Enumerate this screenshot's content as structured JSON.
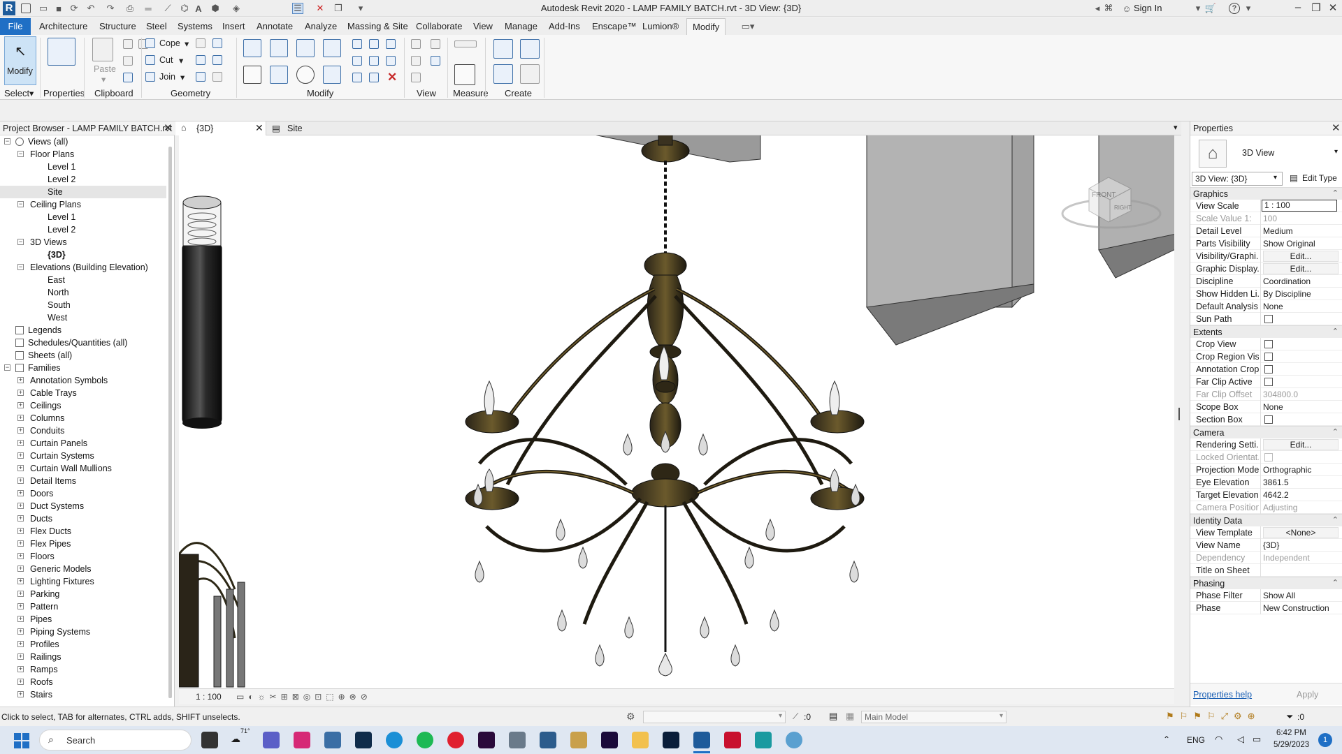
{
  "title_bar": {
    "app_title": "Autodesk Revit 2020 - LAMP FAMILY BATCH.rvt - 3D View: {3D}",
    "sign_in": "Sign In",
    "logo": "R"
  },
  "menu": {
    "tabs": [
      "File",
      "Architecture",
      "Structure",
      "Steel",
      "Systems",
      "Insert",
      "Annotate",
      "Analyze",
      "Massing & Site",
      "Collaborate",
      "View",
      "Manage",
      "Add-Ins",
      "Enscape™",
      "Lumion®",
      "Modify"
    ],
    "active": "Modify"
  },
  "ribbon": {
    "select_panel": {
      "modify_label": "Modify",
      "panel_title": "Select"
    },
    "properties_panel": {
      "label": "Properties"
    },
    "clipboard_panel": {
      "paste_label": "Paste",
      "panel_title": "Clipboard"
    },
    "geometry_panel": {
      "cope": "Cope",
      "cut": "Cut",
      "join": "Join",
      "panel_title": "Geometry"
    },
    "modify_panel": {
      "panel_title": "Modify"
    },
    "view_panel": {
      "panel_title": "View"
    },
    "measure_panel": {
      "panel_title": "Measure"
    },
    "create_panel": {
      "panel_title": "Create"
    }
  },
  "project_browser": {
    "title": "Project Browser - LAMP FAMILY BATCH.rvt",
    "items": [
      {
        "label": "Views (all)",
        "level": 0,
        "expander": "-"
      },
      {
        "label": "Floor Plans",
        "level": 1,
        "expander": "-"
      },
      {
        "label": "Level 1",
        "level": 2
      },
      {
        "label": "Level 2",
        "level": 2
      },
      {
        "label": "Site",
        "level": 2,
        "selected": true
      },
      {
        "label": "Ceiling Plans",
        "level": 1,
        "expander": "-"
      },
      {
        "label": "Level 1",
        "level": 2
      },
      {
        "label": "Level 2",
        "level": 2
      },
      {
        "label": "3D Views",
        "level": 1,
        "expander": "-"
      },
      {
        "label": "{3D}",
        "level": 2,
        "bold": true
      },
      {
        "label": "Elevations (Building Elevation)",
        "level": 1,
        "expander": "-"
      },
      {
        "label": "East",
        "level": 2
      },
      {
        "label": "North",
        "level": 2
      },
      {
        "label": "South",
        "level": 2
      },
      {
        "label": "West",
        "level": 2
      },
      {
        "label": "Legends",
        "level": 0,
        "icon": true
      },
      {
        "label": "Schedules/Quantities (all)",
        "level": 0,
        "icon": true
      },
      {
        "label": "Sheets (all)",
        "level": 0,
        "icon": true
      },
      {
        "label": "Families",
        "level": 0,
        "expander": "-",
        "icon": true
      },
      {
        "label": "Annotation Symbols",
        "level": 1,
        "expander": "+"
      },
      {
        "label": "Cable Trays",
        "level": 1,
        "expander": "+"
      },
      {
        "label": "Ceilings",
        "level": 1,
        "expander": "+"
      },
      {
        "label": "Columns",
        "level": 1,
        "expander": "+"
      },
      {
        "label": "Conduits",
        "level": 1,
        "expander": "+"
      },
      {
        "label": "Curtain Panels",
        "level": 1,
        "expander": "+"
      },
      {
        "label": "Curtain Systems",
        "level": 1,
        "expander": "+"
      },
      {
        "label": "Curtain Wall Mullions",
        "level": 1,
        "expander": "+"
      },
      {
        "label": "Detail Items",
        "level": 1,
        "expander": "+"
      },
      {
        "label": "Doors",
        "level": 1,
        "expander": "+"
      },
      {
        "label": "Duct Systems",
        "level": 1,
        "expander": "+"
      },
      {
        "label": "Ducts",
        "level": 1,
        "expander": "+"
      },
      {
        "label": "Flex Ducts",
        "level": 1,
        "expander": "+"
      },
      {
        "label": "Flex Pipes",
        "level": 1,
        "expander": "+"
      },
      {
        "label": "Floors",
        "level": 1,
        "expander": "+"
      },
      {
        "label": "Generic Models",
        "level": 1,
        "expander": "+"
      },
      {
        "label": "Lighting Fixtures",
        "level": 1,
        "expander": "+"
      },
      {
        "label": "Parking",
        "level": 1,
        "expander": "+"
      },
      {
        "label": "Pattern",
        "level": 1,
        "expander": "+"
      },
      {
        "label": "Pipes",
        "level": 1,
        "expander": "+"
      },
      {
        "label": "Piping Systems",
        "level": 1,
        "expander": "+"
      },
      {
        "label": "Profiles",
        "level": 1,
        "expander": "+"
      },
      {
        "label": "Railings",
        "level": 1,
        "expander": "+"
      },
      {
        "label": "Ramps",
        "level": 1,
        "expander": "+"
      },
      {
        "label": "Roofs",
        "level": 1,
        "expander": "+"
      },
      {
        "label": "Stairs",
        "level": 1,
        "expander": "+"
      }
    ]
  },
  "view_tabs": [
    {
      "label": "{3D}",
      "active": true
    },
    {
      "label": "Site",
      "active": false
    }
  ],
  "viewport": {
    "scale": "1 : 100",
    "viewcube_front": "FRONT",
    "viewcube_right": "RIGHT"
  },
  "properties": {
    "title": "Properties",
    "type_name": "3D View",
    "selector": "3D View: {3D}",
    "edit_type": "Edit Type",
    "sections": [
      {
        "name": "Graphics",
        "rows": [
          {
            "label": "View Scale",
            "value": "1 : 100",
            "boxed": true
          },
          {
            "label": "Scale Value   1:",
            "value": "100",
            "dim": true
          },
          {
            "label": "Detail Level",
            "value": "Medium"
          },
          {
            "label": "Parts Visibility",
            "value": "Show Original"
          },
          {
            "label": "Visibility/Graphi...",
            "value": "Edit...",
            "button": true
          },
          {
            "label": "Graphic Display...",
            "value": "Edit...",
            "button": true
          },
          {
            "label": "Discipline",
            "value": "Coordination"
          },
          {
            "label": "Show Hidden Li...",
            "value": "By Discipline"
          },
          {
            "label": "Default Analysis...",
            "value": "None"
          },
          {
            "label": "Sun Path",
            "value": "",
            "checkbox": true
          }
        ]
      },
      {
        "name": "Extents",
        "rows": [
          {
            "label": "Crop View",
            "value": "",
            "checkbox": true
          },
          {
            "label": "Crop Region Vis...",
            "value": "",
            "checkbox": true
          },
          {
            "label": "Annotation Crop",
            "value": "",
            "checkbox": true
          },
          {
            "label": "Far Clip Active",
            "value": "",
            "checkbox": true
          },
          {
            "label": "Far Clip Offset",
            "value": "304800.0",
            "dim": true
          },
          {
            "label": "Scope Box",
            "value": "None"
          },
          {
            "label": "Section Box",
            "value": "",
            "checkbox": true
          }
        ]
      },
      {
        "name": "Camera",
        "rows": [
          {
            "label": "Rendering Setti...",
            "value": "Edit...",
            "button": true
          },
          {
            "label": "Locked Orientat...",
            "value": "",
            "checkbox": true,
            "dim": true
          },
          {
            "label": "Projection Mode",
            "value": "Orthographic"
          },
          {
            "label": "Eye Elevation",
            "value": "3861.5"
          },
          {
            "label": "Target Elevation",
            "value": "4642.2"
          },
          {
            "label": "Camera Position",
            "value": "Adjusting",
            "dim": true
          }
        ]
      },
      {
        "name": "Identity Data",
        "rows": [
          {
            "label": "View Template",
            "value": "<None>",
            "button": true
          },
          {
            "label": "View Name",
            "value": "{3D}"
          },
          {
            "label": "Dependency",
            "value": "Independent",
            "dim": true
          },
          {
            "label": "Title on Sheet",
            "value": ""
          }
        ]
      },
      {
        "name": "Phasing",
        "rows": [
          {
            "label": "Phase Filter",
            "value": "Show All"
          },
          {
            "label": "Phase",
            "value": "New Construction"
          }
        ]
      }
    ],
    "help_link": "Properties help",
    "apply": "Apply"
  },
  "status_bar": {
    "hint": "Click to select, TAB for alternates, CTRL adds, SHIFT unselects.",
    "selection_count": ":0",
    "model": "Main Model",
    "filter_count": ":0"
  },
  "taskbar": {
    "search_placeholder": "Search",
    "weather": "71°",
    "language": "ENG",
    "time": "6:42 PM",
    "date": "5/29/2023",
    "notifications": "1",
    "colors": {
      "accent": "#1f6fc5",
      "taskbar": "#dfe7f2"
    }
  }
}
